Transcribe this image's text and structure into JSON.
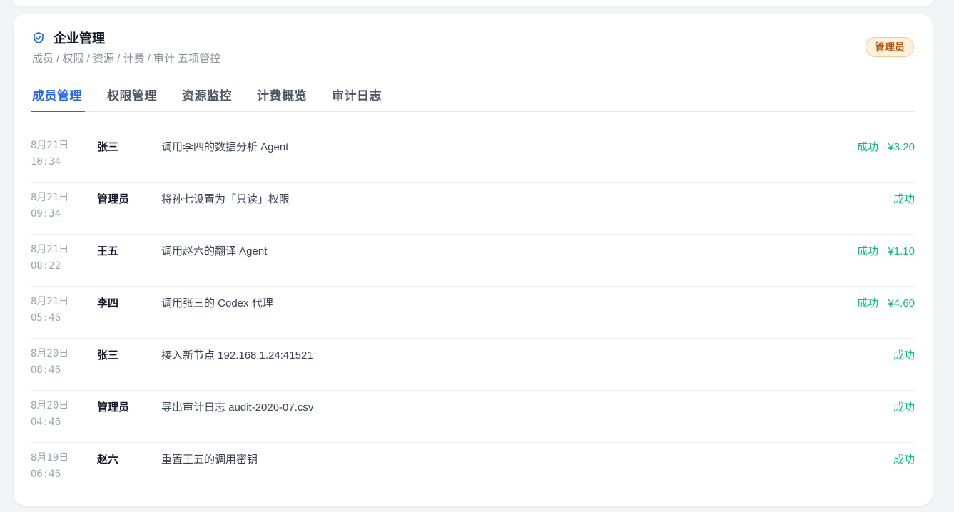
{
  "panel": {
    "title": "企业管理",
    "subtitle": "成员 / 权限 / 资源 / 计费 / 审计 五项管控",
    "role_badge": "管理员"
  },
  "tabs": [
    {
      "label": "成员管理",
      "active": true
    },
    {
      "label": "权限管理",
      "active": false
    },
    {
      "label": "资源监控",
      "active": false
    },
    {
      "label": "计费概览",
      "active": false
    },
    {
      "label": "审计日志",
      "active": false
    }
  ],
  "log": [
    {
      "date": "8月21日",
      "time": "10:34",
      "actor": "张三",
      "action": "调用李四的数据分析 Agent",
      "status": "成功 · ¥3.20"
    },
    {
      "date": "8月21日",
      "time": "09:34",
      "actor": "管理员",
      "action": "将孙七设置为「只读」权限",
      "status": "成功"
    },
    {
      "date": "8月21日",
      "time": "08:22",
      "actor": "王五",
      "action": "调用赵六的翻译 Agent",
      "status": "成功 · ¥1.10"
    },
    {
      "date": "8月21日",
      "time": "05:46",
      "actor": "李四",
      "action": "调用张三的 Codex 代理",
      "status": "成功 · ¥4.60"
    },
    {
      "date": "8月20日",
      "time": "08:46",
      "actor": "张三",
      "action": "接入新节点 192.168.1.24:41521",
      "status": "成功"
    },
    {
      "date": "8月20日",
      "time": "04:46",
      "actor": "管理员",
      "action": "导出审计日志 audit-2026-07.csv",
      "status": "成功"
    },
    {
      "date": "8月19日",
      "time": "06:46",
      "actor": "赵六",
      "action": "重置王五的调用密钥",
      "status": "成功"
    }
  ],
  "colors": {
    "accent": "#2563eb",
    "success": "#10b981",
    "badge_bg": "#fdf0de",
    "badge_text": "#b45309"
  },
  "icons": {
    "title": "shield-check-icon"
  }
}
